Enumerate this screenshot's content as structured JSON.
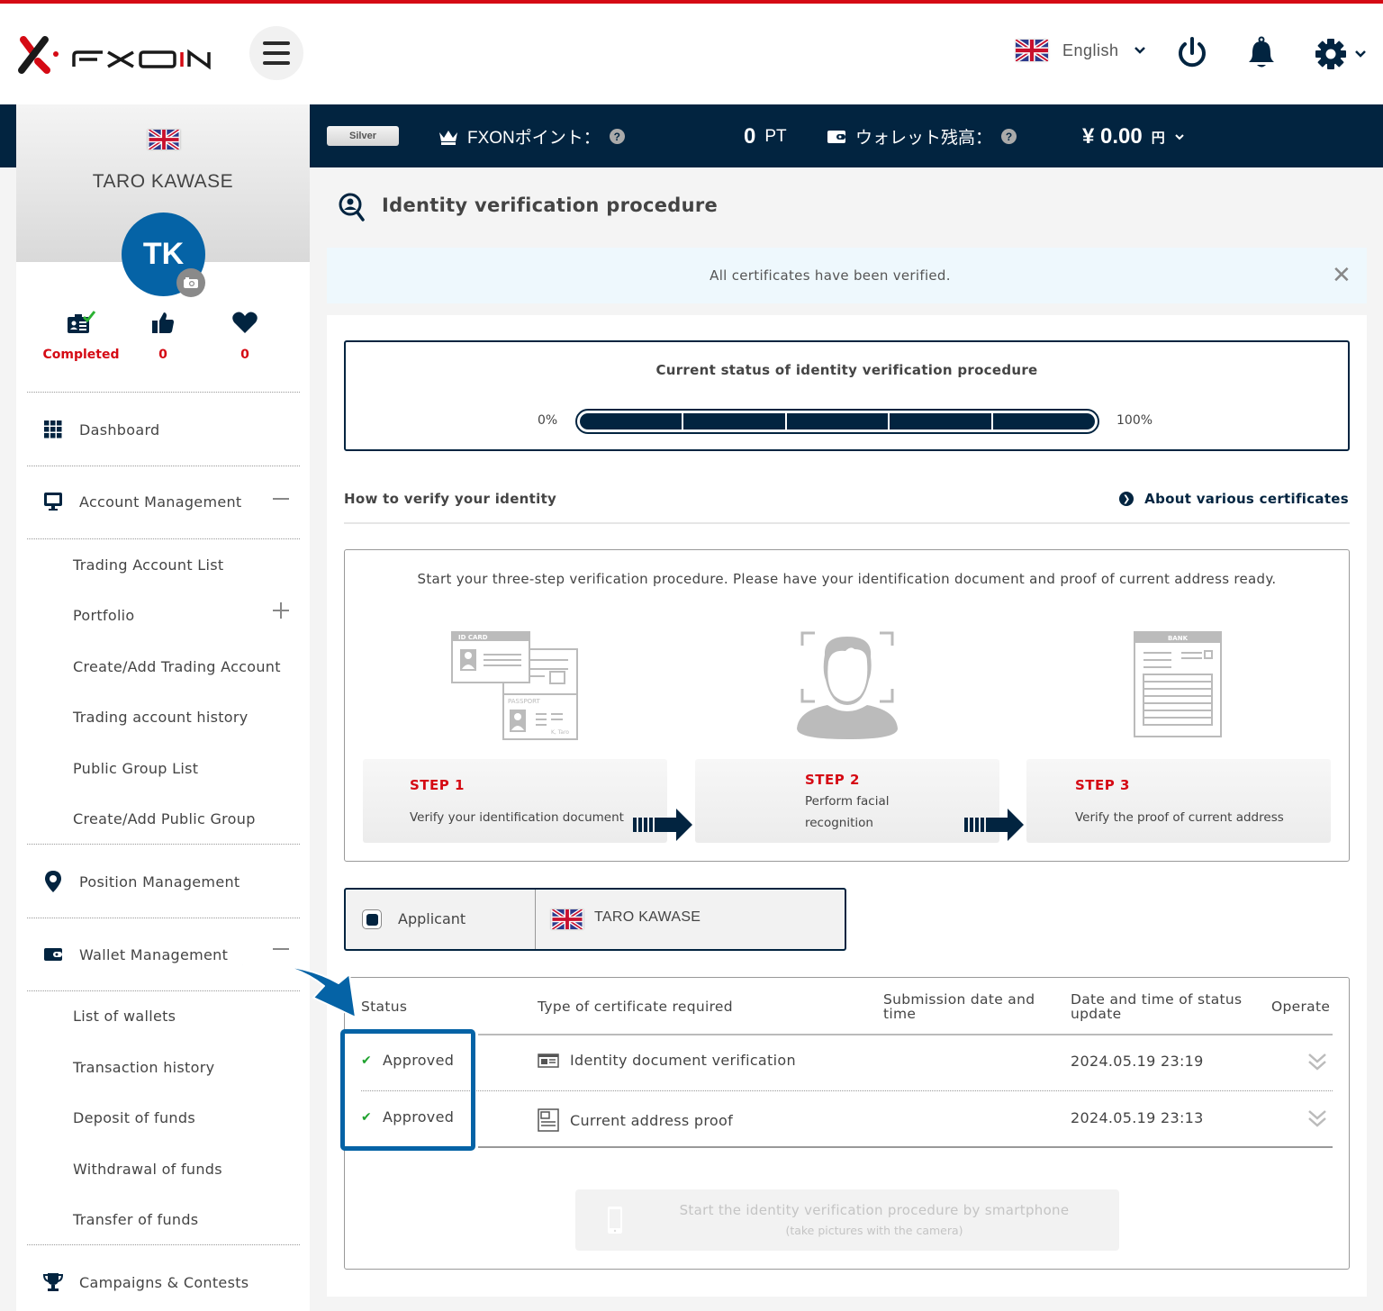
{
  "brand": {
    "name": "FXON",
    "accent": "#d50a14",
    "navy": "#022440",
    "blue": "#0563a6"
  },
  "header": {
    "language": "English",
    "icons": [
      "menu-icon",
      "uk-flag-icon",
      "chevron-down-icon",
      "power-icon",
      "bell-icon",
      "gear-icon"
    ]
  },
  "topbar": {
    "tier": "Silver",
    "points_label": "FXONポイント：",
    "points_value": "0",
    "points_unit": "PT",
    "wallet_label": "ウォレット残高：",
    "wallet_value": "¥ 0.00",
    "wallet_unit": "円"
  },
  "profile": {
    "name": "TARO KAWASE",
    "initials": "TK",
    "stats": [
      {
        "icon": "id-card-check-icon",
        "value": "Completed"
      },
      {
        "icon": "thumbs-up-icon",
        "value": "0"
      },
      {
        "icon": "heart-icon",
        "value": "0"
      }
    ]
  },
  "sidebar": {
    "dashboard": "Dashboard",
    "account_management": {
      "label": "Account Management",
      "items": [
        "Trading Account List",
        "Portfolio",
        "Create/Add Trading Account",
        "Trading account history",
        "Public Group List",
        "Create/Add Public Group"
      ]
    },
    "position_management": "Position Management",
    "wallet_management": {
      "label": "Wallet Management",
      "items": [
        "List of wallets",
        "Transaction history",
        "Deposit of funds",
        "Withdrawal of funds",
        "Transfer of funds"
      ]
    },
    "campaigns": "Campaigns & Contests"
  },
  "page": {
    "title": "Identity verification procedure",
    "alert": "All certificates have been verified.",
    "status_title": "Current status of identity verification procedure",
    "progress": {
      "min_label": "0%",
      "max_label": "100%",
      "value_percent": 100,
      "segments": 5
    },
    "howto": "How to verify your identity",
    "about_link": "About various certificates",
    "intro": "Start your three-step verification procedure. Please have your identification document and proof of current address ready.",
    "steps": [
      {
        "title": "STEP 1",
        "desc": "Verify your identification document",
        "illustration": "id-card-passport-illustration",
        "id_label": "ID CARD",
        "passport_label": "PASSPORT",
        "passport_name": "K, Taro"
      },
      {
        "title": "STEP 2",
        "desc": "Perform facial recognition",
        "illustration": "face-scan-illustration"
      },
      {
        "title": "STEP 3",
        "desc": "Verify the proof of current address",
        "illustration": "bank-statement-illustration",
        "bank_label": "BANK"
      }
    ],
    "applicant": {
      "label": "Applicant",
      "name": "TARO KAWASE"
    },
    "table": {
      "headers": [
        "Status",
        "Type of certificate required",
        "Submission date and time",
        "Date and time of status update",
        "Operate"
      ],
      "rows": [
        {
          "status": "Approved",
          "type": "Identity document verification",
          "submitted": "",
          "updated": "2024.05.19 23:19"
        },
        {
          "status": "Approved",
          "type": "Current address proof",
          "submitted": "",
          "updated": "2024.05.19 23:13"
        }
      ]
    },
    "smartphone_button": {
      "line1": "Start the identity verification procedure by smartphone",
      "line2": "(take pictures with the camera)"
    }
  }
}
